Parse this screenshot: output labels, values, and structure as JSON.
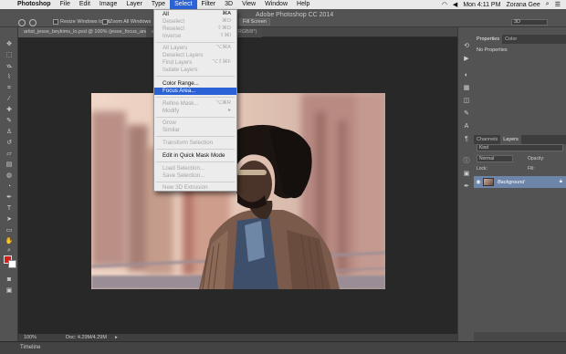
{
  "menubar": {
    "app_name": "Photoshop",
    "menus": [
      "File",
      "Edit",
      "Image",
      "Layer",
      "Type",
      "Select",
      "Filter",
      "3D",
      "View",
      "Window",
      "Help"
    ],
    "active_menu": "Select",
    "clock": "Mon 4:11 PM",
    "user": "Zorana Gee"
  },
  "optbar": {
    "app_title": "Adobe Photoshop CC 2014",
    "resize_windows": "Resize Windows to Fit",
    "zoom_all": "Zoom All Windows",
    "fill_screen": "Fill Screen",
    "workspace": "3D"
  },
  "document": {
    "tab1": "artist_jesse_beykims_lo.psd @ 100% (jesse_focus_area, RGB/8)",
    "tab2": "artist_jesse_beykims_lo.psd @ 100% (RGB/8*)",
    "zoom": "100%",
    "doc_size": "Doc: 4.29M/4.29M"
  },
  "select_menu": {
    "items": [
      {
        "label": "All",
        "shortcut": "⌘A",
        "disabled": false
      },
      {
        "label": "Deselect",
        "shortcut": "⌘D",
        "disabled": true
      },
      {
        "label": "Reselect",
        "shortcut": "⇧⌘D",
        "disabled": true
      },
      {
        "label": "Inverse",
        "shortcut": "⇧⌘I",
        "disabled": true
      },
      {
        "label": "All Layers",
        "shortcut": "⌥⌘A",
        "disabled": true
      },
      {
        "label": "Deselect Layers",
        "shortcut": "",
        "disabled": true
      },
      {
        "label": "Find Layers",
        "shortcut": "⌥⇧⌘F",
        "disabled": true
      },
      {
        "label": "Isolate Layers",
        "shortcut": "",
        "disabled": true
      },
      {
        "label": "Color Range...",
        "shortcut": "",
        "disabled": false
      },
      {
        "label": "Focus Area...",
        "shortcut": "",
        "disabled": false,
        "highlighted": true
      },
      {
        "label": "Refine Mask...",
        "shortcut": "⌥⌘R",
        "disabled": true
      },
      {
        "label": "Modify",
        "shortcut": "▸",
        "disabled": true
      },
      {
        "label": "Grow",
        "shortcut": "",
        "disabled": true
      },
      {
        "label": "Similar",
        "shortcut": "",
        "disabled": true
      },
      {
        "label": "Transform Selection",
        "shortcut": "",
        "disabled": true
      },
      {
        "label": "Edit in Quick Mask Mode",
        "shortcut": "",
        "disabled": false
      },
      {
        "label": "Load Selection...",
        "shortcut": "",
        "disabled": true
      },
      {
        "label": "Save Selection...",
        "shortcut": "",
        "disabled": true
      },
      {
        "label": "New 3D Extrusion",
        "shortcut": "",
        "disabled": true
      }
    ]
  },
  "panels": {
    "properties_tab": "Properties",
    "color_tab": "Color",
    "properties_label": "No Properties",
    "channels_tab": "Channels",
    "layers_tab": "Layers",
    "filter_kind": "Kind",
    "blend_mode": "Normal",
    "opacity_label": "Opacity:",
    "lock_label": "Lock:",
    "fill_label": "Fill:",
    "layer_name": "Background"
  },
  "timeline": {
    "label": "Timeline"
  },
  "colors": {
    "menu_highlight": "#2b63d6",
    "foreground": "#d0211c",
    "background": "#ffffff"
  }
}
